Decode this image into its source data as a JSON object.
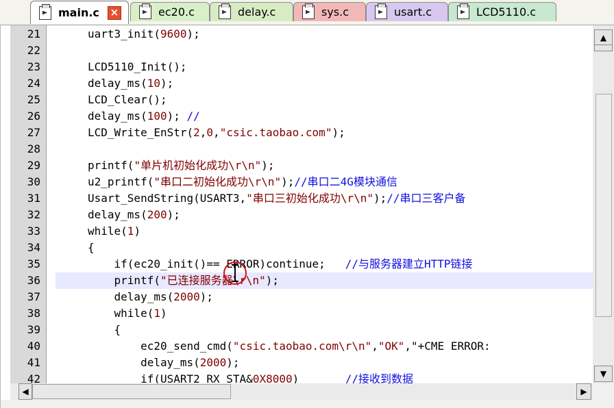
{
  "tabs": [
    {
      "label": "main.c",
      "active": true
    },
    {
      "label": "ec20.c"
    },
    {
      "label": "delay.c"
    },
    {
      "label": "sys.c"
    },
    {
      "label": "usart.c"
    },
    {
      "label": "LCD5110.c"
    }
  ],
  "close_glyph": "×",
  "colors": {
    "tab_main": "#ffffff",
    "tab_ec20": "#d8f0c8",
    "tab_delay": "#d8ecc4",
    "tab_sys": "#f2b8b8",
    "tab_usart": "#d8c8f0",
    "tab_lcd": "#c8e8d0",
    "number_color": "#800000",
    "comment_color": "#1010e0",
    "current_line": "#e8e8ff"
  },
  "code": {
    "current_line": 36,
    "lines": [
      {
        "n": "21",
        "t": "uart3_init(9600);"
      },
      {
        "n": "22",
        "t": ""
      },
      {
        "n": "23",
        "t": "LCD5110_Init();"
      },
      {
        "n": "24",
        "t": "delay_ms(10);"
      },
      {
        "n": "25",
        "t": "LCD_Clear();"
      },
      {
        "n": "26",
        "t": "delay_ms(100); //"
      },
      {
        "n": "27",
        "t": "LCD_Write_EnStr(2,0,\"csic.taobao.com\");"
      },
      {
        "n": "28",
        "t": ""
      },
      {
        "n": "29",
        "t": "printf(\"单片机初始化成功\\r\\n\");"
      },
      {
        "n": "30",
        "t": "u2_printf(\"串口二初始化成功\\r\\n\");//串口二4G模块通信"
      },
      {
        "n": "31",
        "t": "Usart_SendString(USART3,\"串口三初始化成功\\r\\n\");//串口三客户备"
      },
      {
        "n": "32",
        "t": "delay_ms(200);"
      },
      {
        "n": "33",
        "t": "while(1)"
      },
      {
        "n": "34",
        "t": "{"
      },
      {
        "n": "35",
        "t": "    if(ec20_init()== ERROR)continue;   //与服务器建立HTTP链接"
      },
      {
        "n": "36",
        "t": "    printf(\"已连接服务器\\r\\n\");"
      },
      {
        "n": "37",
        "t": "    delay_ms(2000);"
      },
      {
        "n": "38",
        "t": "    while(1)"
      },
      {
        "n": "39",
        "t": "    {"
      },
      {
        "n": "40",
        "t": "        ec20_send_cmd(\"csic.taobao.com\\r\\n\",\"OK\",\"+CME ERROR:"
      },
      {
        "n": "41",
        "t": "        delay_ms(2000);"
      },
      {
        "n": "42",
        "t": "        if(USART2_RX_STA&0X8000)       //接收到数据"
      }
    ]
  },
  "scrollbar": {
    "up": "▲",
    "down": "▼",
    "left": "◀",
    "right": "▶"
  }
}
